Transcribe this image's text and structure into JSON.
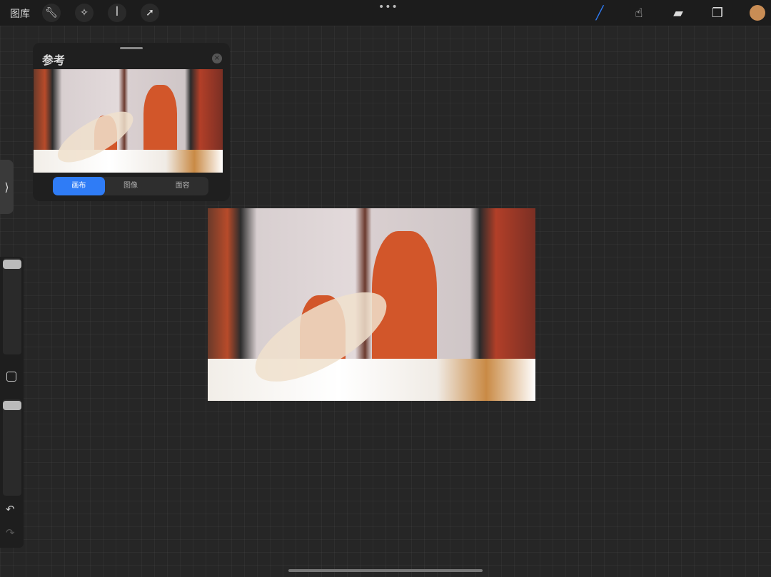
{
  "topbar": {
    "gallery": "图库",
    "tools_left": [
      "wrench-icon",
      "magic-wand-icon",
      "selection-icon",
      "transform-arrow-icon"
    ],
    "more": "•••",
    "tools_right": [
      "brush-icon",
      "smudge-icon",
      "eraser-icon",
      "layers-icon"
    ],
    "current_color": "#c98d55",
    "active_tool": "brush",
    "accent": "#2f7cf6"
  },
  "reference": {
    "title": "参考",
    "close": "×",
    "tabs": [
      "画布",
      "图像",
      "面容"
    ],
    "active_tab": 0
  },
  "sidebar": {
    "toggle": "⟩",
    "undo": "↶",
    "redo": "↷"
  }
}
